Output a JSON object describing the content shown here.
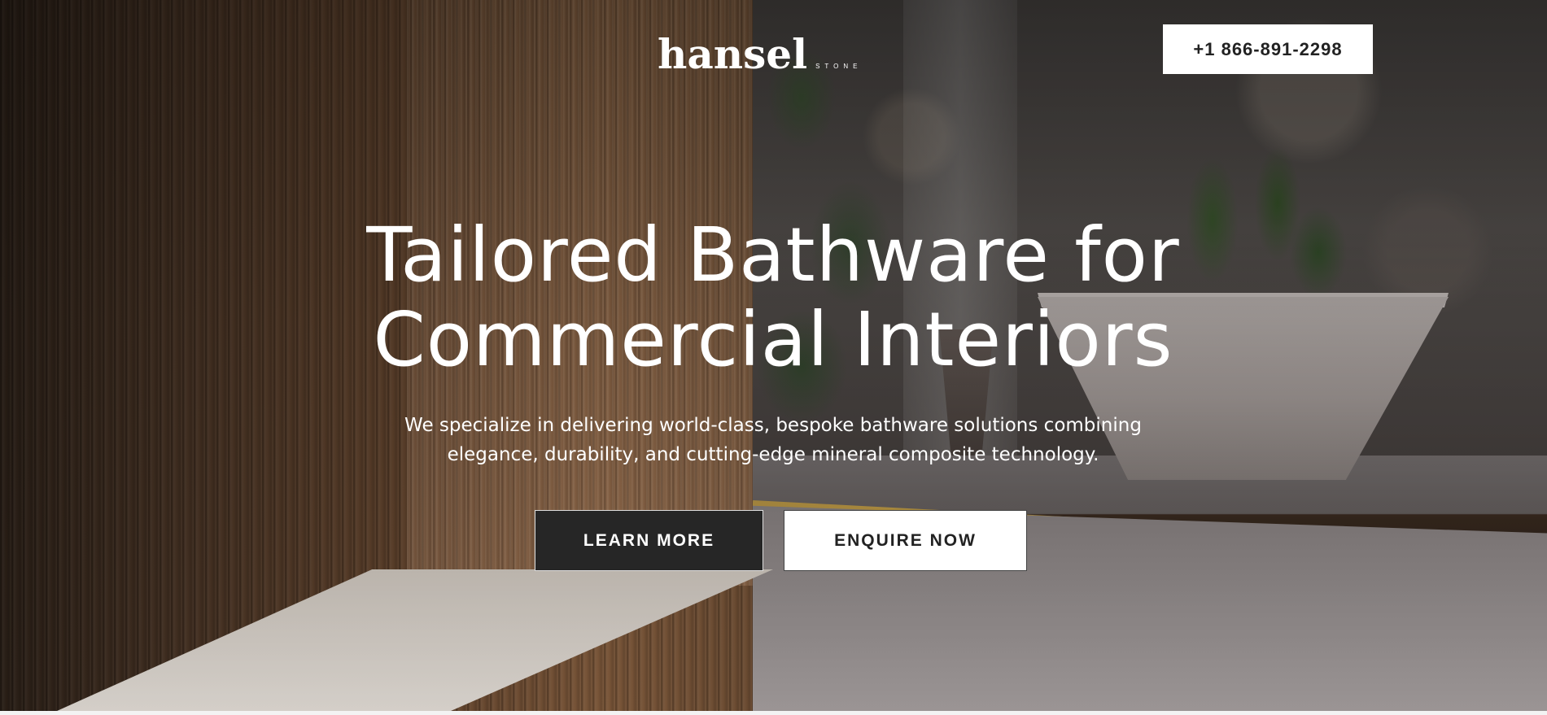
{
  "header": {
    "logo_main": "hansel",
    "logo_sub": "STONE",
    "phone_label": "+1 866-891-2298"
  },
  "hero": {
    "headline_line1": "Tailored Bathware for",
    "headline_line2": "Commercial Interiors",
    "subtext_line1": "We specialize in delivering world-class, bespoke bathware solutions combining",
    "subtext_line2": "elegance, durability, and cutting-edge mineral composite technology.",
    "learn_more_label": "LEARN MORE",
    "enquire_label": "ENQUIRE NOW"
  },
  "colors": {
    "primary_dark": "#262626",
    "text_light": "#ffffff",
    "accent_led": "#e6b43c"
  }
}
